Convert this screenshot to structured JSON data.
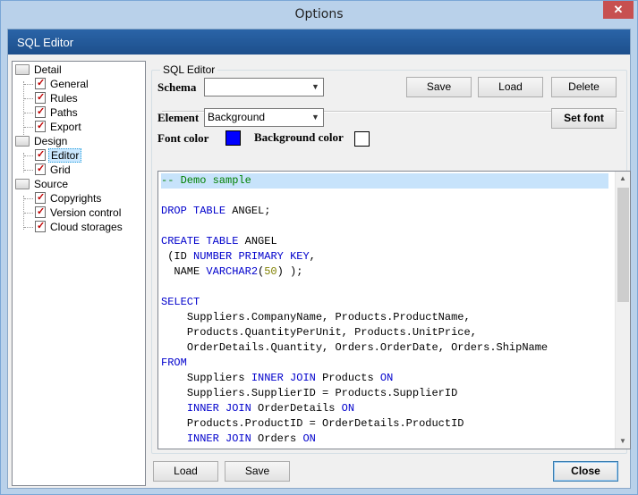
{
  "window": {
    "title": "Options",
    "close_glyph": "✕"
  },
  "header": {
    "title": "SQL Editor"
  },
  "tree": {
    "items": [
      {
        "label": "Detail",
        "kind": "folder"
      },
      {
        "label": "General",
        "kind": "page"
      },
      {
        "label": "Rules",
        "kind": "page"
      },
      {
        "label": "Paths",
        "kind": "page"
      },
      {
        "label": "Export",
        "kind": "page"
      },
      {
        "label": "Design",
        "kind": "folder"
      },
      {
        "label": "Editor",
        "kind": "page",
        "selected": true
      },
      {
        "label": "Grid",
        "kind": "page"
      },
      {
        "label": "Source",
        "kind": "folder"
      },
      {
        "label": "Copyrights",
        "kind": "page"
      },
      {
        "label": "Version control",
        "kind": "page"
      },
      {
        "label": "Cloud storages",
        "kind": "page"
      }
    ]
  },
  "group": {
    "title": "SQL Editor"
  },
  "schema": {
    "label": "Schema",
    "value": ""
  },
  "schema_buttons": {
    "save": "Save",
    "load": "Load",
    "delete": "Delete"
  },
  "element": {
    "label": "Element",
    "value": "Background",
    "set_font": "Set font"
  },
  "colors": {
    "font_label": "Font color",
    "font_color": "#0000ff",
    "background_label": "Background color",
    "background_color": "#ffffff"
  },
  "code": {
    "lines": [
      "-- Demo sample",
      "",
      "DROP TABLE ANGEL;",
      "",
      "CREATE TABLE ANGEL",
      " (ID NUMBER PRIMARY KEY,",
      "  NAME VARCHAR2(50) );",
      "",
      "SELECT",
      "    Suppliers.CompanyName, Products.ProductName,",
      "    Products.QuantityPerUnit, Products.UnitPrice,",
      "    OrderDetails.Quantity, Orders.OrderDate, Orders.ShipName",
      "FROM",
      "    Suppliers INNER JOIN Products ON",
      "    Suppliers.SupplierID = Products.SupplierID",
      "    INNER JOIN OrderDetails ON",
      "    Products.ProductID = OrderDetails.ProductID",
      "    INNER JOIN Orders ON"
    ]
  },
  "footer": {
    "load": "Load",
    "save": "Save",
    "close": "Close"
  }
}
